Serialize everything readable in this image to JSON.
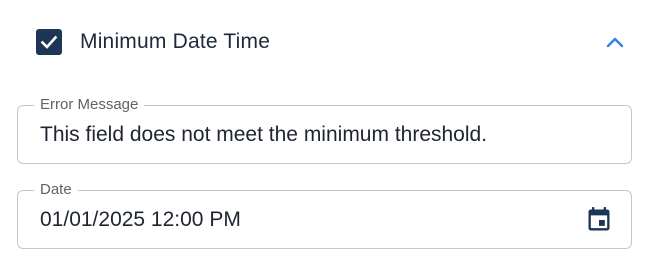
{
  "section": {
    "title": "Minimum Date Time",
    "checked": true,
    "expanded": true
  },
  "error_message": {
    "label": "Error Message",
    "value": "This field does not meet the minimum threshold."
  },
  "date": {
    "label": "Date",
    "value": "01/01/2025 12:00 PM"
  },
  "icons": {
    "checkbox": "check-icon",
    "collapse": "chevron-up-icon",
    "calendar": "calendar-icon"
  },
  "colors": {
    "checkbox_fill": "#1d3557",
    "chevron": "#2f80ed",
    "calendar_icon": "#1d3557",
    "border": "#c4c7cc"
  }
}
